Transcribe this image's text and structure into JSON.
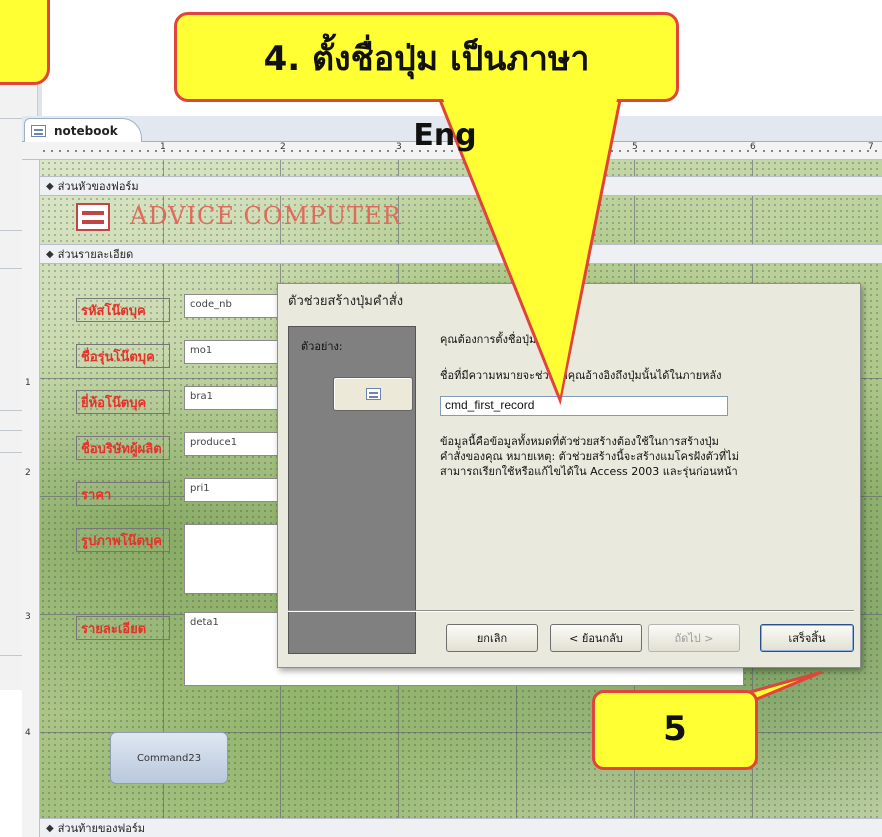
{
  "window": {
    "tab_label": "notebook"
  },
  "ruler": {
    "h_numbers": [
      "1",
      "2",
      "3",
      "5",
      "6",
      "7"
    ],
    "v_numbers": [
      "1",
      "2",
      "3",
      "4"
    ]
  },
  "form": {
    "sections": {
      "header": "ส่วนหัวของฟอร์ม",
      "detail": "ส่วนรายละเอียด",
      "footer": "ส่วนท้ายของฟอร์ม"
    },
    "header_title": "ADVICE COMPUTER",
    "fields": [
      {
        "label": "รหัสโน๊ตบุค",
        "control": "code_nb"
      },
      {
        "label": "ชื่อรุ่นโน๊ตบุค",
        "control": "mo1"
      },
      {
        "label": "ยี่ห้อโน๊ตบุค",
        "control": "bra1"
      },
      {
        "label": "ชื่อบริษัทผู้ผลิต",
        "control": "produce1"
      },
      {
        "label": "ราคา",
        "control": "pri1"
      },
      {
        "label": "รูปภาพโน๊ตบุค",
        "control": ""
      },
      {
        "label": "รายละเอียด",
        "control": "deta1"
      }
    ],
    "command_button": "Command23"
  },
  "dialog": {
    "title": "ตัวช่วยสร้างปุ่มคำสั่ง",
    "preview_label": "ตัวอย่าง:",
    "question": "คุณต้องการตั้งชื่อปุ่มว่าอะไร",
    "hint": "ชื่อที่มีความหมายจะช่วยให้คุณอ้างอิงถึงปุ่มนั้นได้ในภายหลัง",
    "name_value": "cmd_first_record",
    "info_lines": [
      "ข้อมูลนี้คือข้อมูลทั้งหมดที่ตัวช่วยสร้างต้องใช้ในการสร้างปุ่ม",
      "คำสั่งของคุณ หมายเหตุ: ตัวช่วยสร้างนี้จะสร้างแมโครฝังตัวที่ไม่",
      "สามารถเรียกใช้หรือแก้ไขได้ใน Access 2003 และรุ่นก่อนหน้า"
    ],
    "buttons": {
      "cancel": "ยกเลิก",
      "back": "< ย้อนกลับ",
      "next": "ถัดไป >",
      "finish": "เสร็จสิ้น"
    }
  },
  "annotations": {
    "top_callout": "4. ตั้งชื่อปุ่ม เป็นภาษา",
    "top_callout_suffix": "Eng",
    "step_callout": "5",
    "callout_fill": "#ffff33",
    "callout_border": "#e0443a"
  }
}
